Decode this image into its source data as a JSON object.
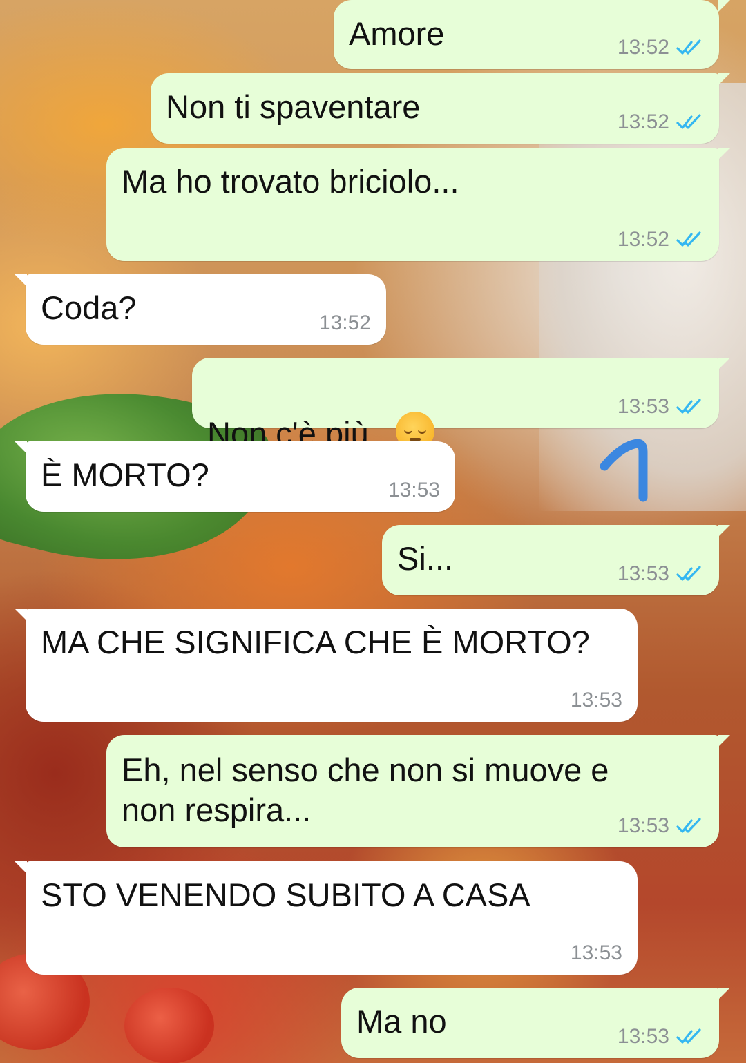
{
  "colors": {
    "outgoing_bubble": "#e7fed8",
    "incoming_bubble": "#ffffff",
    "read_ticks": "#34b7f1",
    "timestamp": "#8c9094",
    "annotation_stroke": "#3b87e0"
  },
  "messages": [
    {
      "direction": "out",
      "text": "Amore",
      "time": "13:52",
      "status": "read"
    },
    {
      "direction": "out",
      "text": "Non ti spaventare",
      "time": "13:52",
      "status": "read"
    },
    {
      "direction": "out",
      "text": "Ma ho trovato briciolo...",
      "time": "13:52",
      "status": "read"
    },
    {
      "direction": "in",
      "text": "Coda?",
      "time": "13:52"
    },
    {
      "direction": "out",
      "text": "Non c'è più...",
      "emoji": "pensive-face",
      "time": "13:53",
      "status": "read"
    },
    {
      "direction": "in",
      "text": "È MORTO?",
      "time": "13:53"
    },
    {
      "direction": "out",
      "text": "Si...",
      "time": "13:53",
      "status": "read"
    },
    {
      "direction": "in",
      "text": "MA CHE SIGNIFICA CHE È MORTO?",
      "time": "13:53"
    },
    {
      "direction": "out",
      "text": "Eh, nel senso che non si muove e\nnon respira...",
      "time": "13:53",
      "status": "read"
    },
    {
      "direction": "in",
      "text": "STO VENENDO SUBITO A CASA",
      "time": "13:53"
    },
    {
      "direction": "out",
      "text": "Ma no",
      "time": "13:53",
      "status": "read"
    }
  ],
  "annotation": {
    "icon": "hand-drawn-hook-mark"
  }
}
